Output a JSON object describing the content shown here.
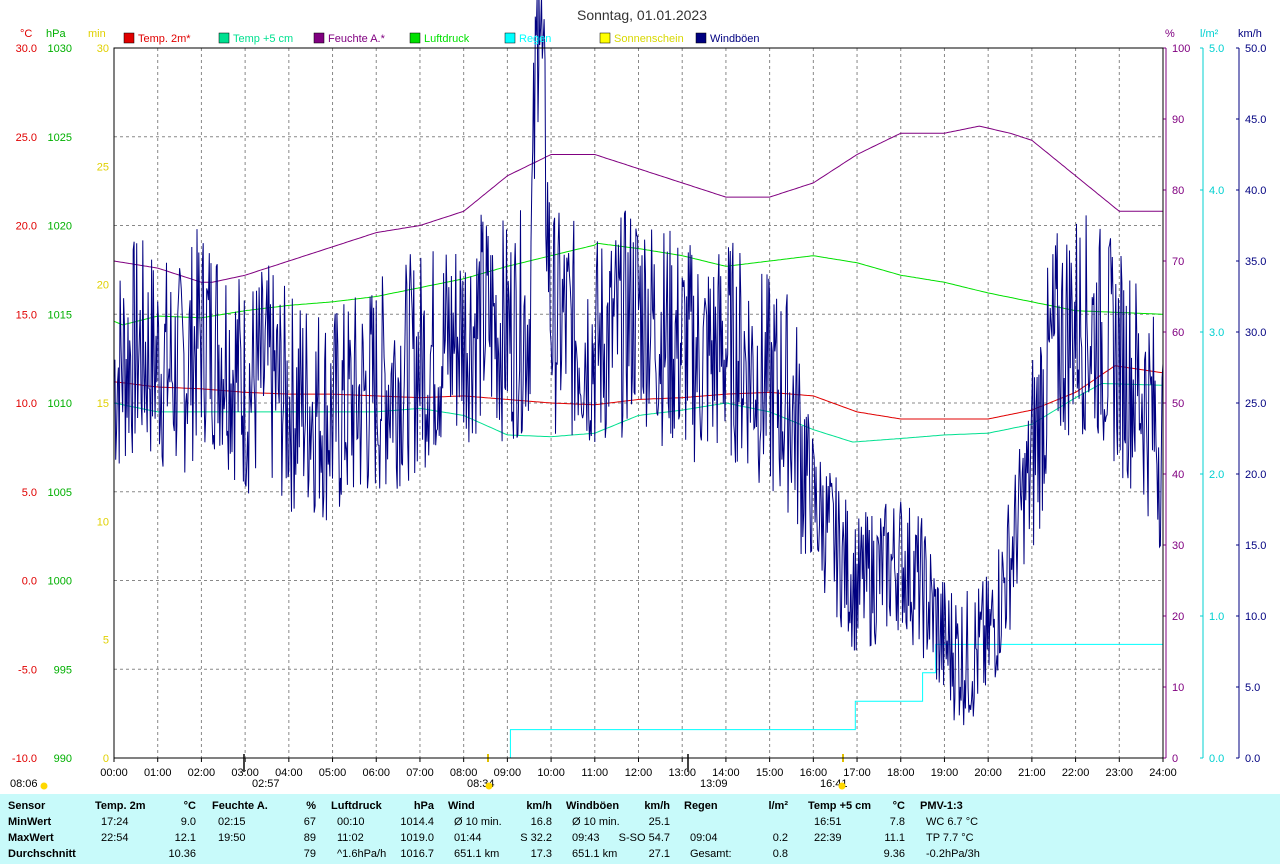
{
  "chart_data": {
    "type": "line",
    "title": "Sonntag, 01.01.2023",
    "x_ticks": [
      "00:00",
      "01:00",
      "02:00",
      "03:00",
      "04:00",
      "05:00",
      "06:00",
      "07:00",
      "08:00",
      "09:00",
      "10:00",
      "11:00",
      "12:00",
      "13:00",
      "14:00",
      "15:00",
      "16:00",
      "17:00",
      "18:00",
      "19:00",
      "20:00",
      "21:00",
      "22:00",
      "23:00",
      "24:00"
    ],
    "axes": {
      "temp": {
        "unit": "°C",
        "min": -10,
        "max": 30,
        "ticks": [
          "30.0",
          "25.0",
          "20.0",
          "15.0",
          "10.0",
          "5.0",
          "0.0",
          "-5.0",
          "-10.0"
        ]
      },
      "pressure": {
        "unit": "hPa",
        "min": 990,
        "max": 1030,
        "ticks": [
          "1030",
          "1025",
          "1020",
          "1015",
          "1010",
          "1005",
          "1000",
          "995",
          "990"
        ]
      },
      "sun": {
        "unit": "min",
        "min": 0,
        "max": 30,
        "ticks": [
          "30",
          "25",
          "20",
          "15",
          "10",
          "5",
          "0"
        ]
      },
      "humidity": {
        "unit": "%",
        "min": 0,
        "max": 100,
        "ticks": [
          "100",
          "90",
          "80",
          "70",
          "60",
          "50",
          "40",
          "30",
          "20",
          "10",
          "0"
        ]
      },
      "rain": {
        "unit": "l/m²",
        "min": 0,
        "max": 5,
        "ticks": [
          "5.0",
          "4.0",
          "3.0",
          "2.0",
          "1.0",
          "0.0"
        ]
      },
      "wind": {
        "unit": "km/h",
        "min": 0,
        "max": 50,
        "ticks": [
          "50.0",
          "45.0",
          "40.0",
          "35.0",
          "30.0",
          "25.0",
          "20.0",
          "15.0",
          "10.0",
          "5.0",
          "0.0"
        ]
      }
    },
    "legend": [
      {
        "name": "Temp. 2m*",
        "color": "#e00000"
      },
      {
        "name": "Temp +5 cm",
        "color": "#00e090"
      },
      {
        "name": "Feuchte A.*",
        "color": "#800080"
      },
      {
        "name": "Luftdruck",
        "color": "#00e000"
      },
      {
        "name": "Regen",
        "color": "#00ffff"
      },
      {
        "name": "Sonnenschein",
        "color": "#ffff00"
      },
      {
        "name": "Windböen",
        "color": "#000080"
      }
    ],
    "series": [
      {
        "name": "Temp. 2m*",
        "axis": "temp",
        "color": "#e00000",
        "x": [
          0,
          1,
          2,
          3,
          4,
          5,
          6,
          7,
          8,
          9,
          10,
          11,
          12,
          13,
          14,
          15,
          16,
          17,
          18,
          19,
          20,
          21,
          22,
          22.9,
          24
        ],
        "values": [
          11.2,
          10.9,
          10.8,
          10.6,
          10.5,
          10.5,
          10.4,
          10.3,
          10.4,
          10.2,
          10.0,
          9.9,
          10.2,
          10.3,
          10.5,
          10.6,
          10.4,
          9.5,
          9.1,
          9.1,
          9.1,
          9.6,
          10.6,
          12.1,
          11.7
        ]
      },
      {
        "name": "Temp +5 cm",
        "axis": "temp",
        "color": "#00e090",
        "x": [
          0,
          1,
          2,
          3,
          4,
          5,
          6,
          7,
          8,
          9,
          10,
          11,
          12,
          13,
          14,
          15,
          16,
          16.9,
          18,
          19,
          20,
          21,
          22,
          22.6,
          24
        ],
        "values": [
          10,
          9.5,
          9.5,
          9.5,
          9.5,
          9.5,
          9.5,
          9.7,
          9.3,
          8.2,
          8.1,
          8.3,
          9.3,
          9.6,
          10.0,
          9.5,
          8.5,
          7.8,
          8.0,
          8.2,
          8.3,
          8.8,
          10.3,
          11.1,
          11.0
        ]
      },
      {
        "name": "Feuchte A.*",
        "axis": "humidity",
        "color": "#800080",
        "x": [
          0,
          1,
          2,
          2.25,
          3,
          4,
          5,
          6,
          7,
          8,
          9,
          10,
          10.5,
          11,
          12,
          13,
          14,
          15,
          16,
          17,
          18,
          19,
          19.8,
          20.5,
          21,
          22,
          23,
          24
        ],
        "values": [
          70,
          69,
          67,
          67,
          68,
          70,
          72,
          74,
          75,
          77,
          82,
          85,
          85,
          85,
          83,
          81,
          79,
          79,
          81,
          85,
          88,
          88,
          89,
          88,
          87,
          82,
          77,
          77
        ]
      },
      {
        "name": "Luftdruck",
        "axis": "pressure",
        "color": "#00e000",
        "x": [
          0,
          0.2,
          1,
          2,
          3,
          4,
          5,
          6,
          7,
          8,
          9,
          10,
          11,
          11.05,
          12,
          13,
          14,
          15,
          16,
          17,
          18,
          19,
          20,
          21,
          22,
          23,
          24
        ],
        "values": [
          1014.6,
          1014.4,
          1014.9,
          1014.8,
          1015.2,
          1015.5,
          1015.7,
          1016.0,
          1016.5,
          1017.0,
          1017.7,
          1018.3,
          1018.9,
          1019.0,
          1018.7,
          1018.3,
          1017.7,
          1018.0,
          1018.3,
          1017.9,
          1017.2,
          1016.8,
          1016.2,
          1015.7,
          1015.2,
          1015.1,
          1015.0
        ]
      },
      {
        "name": "Regen",
        "axis": "rain",
        "color": "#00ffff",
        "x": [
          0,
          9.06,
          9.07,
          16.95,
          16.96,
          18.3,
          18.5,
          18.8,
          24
        ],
        "values": [
          0,
          0,
          0.2,
          0.2,
          0.4,
          0.4,
          0.6,
          0.8,
          0.8
        ]
      },
      {
        "name": "Windböen",
        "axis": "wind",
        "color": "#000080",
        "x": [
          0,
          0.5,
          1,
          1.5,
          2,
          2.5,
          3,
          3.5,
          4,
          4.5,
          5,
          5.5,
          6,
          6.5,
          7,
          7.5,
          8,
          8.5,
          9,
          9.5,
          9.72,
          10,
          10.5,
          11,
          11.5,
          12,
          12.5,
          13,
          13.5,
          14,
          14.5,
          15,
          15.5,
          16,
          16.5,
          17,
          17.5,
          18,
          18.5,
          19,
          19.5,
          20,
          20.5,
          21,
          21.5,
          22,
          22.5,
          23,
          23.5,
          24
        ],
        "values": [
          27,
          29,
          28,
          27,
          30,
          29,
          26,
          27,
          25,
          25,
          24,
          25,
          26,
          27,
          28,
          29,
          30,
          31,
          30,
          31,
          54.7,
          31,
          30,
          29,
          30,
          32,
          30,
          29,
          28,
          29,
          28,
          26,
          25,
          18,
          15,
          12,
          13,
          14,
          12,
          8,
          7,
          8,
          14,
          21,
          29,
          31,
          30,
          28,
          26,
          22
        ]
      }
    ],
    "markers": [
      {
        "label": "08:06"
      },
      {
        "label": "02:57"
      },
      {
        "label": "08:34"
      },
      {
        "label": "13:09"
      },
      {
        "label": "16:41"
      }
    ]
  },
  "stats": {
    "headers": [
      {
        "label": "Sensor",
        "unit": ""
      },
      {
        "label": "Temp. 2m",
        "unit": "°C"
      },
      {
        "label": "Feuchte A.",
        "unit": "%"
      },
      {
        "label": "Luftdruck",
        "unit": "hPa"
      },
      {
        "label": "Wind",
        "unit": "km/h"
      },
      {
        "label": "Windböen",
        "unit": "km/h"
      },
      {
        "label": "Regen",
        "unit": "l/m²"
      },
      {
        "label": "Temp +5 cm",
        "unit": "°C"
      },
      {
        "label": "PMV-1:3",
        "unit": ""
      }
    ],
    "rows": [
      {
        "label": "MinWert",
        "cells": [
          [
            "17:24",
            "9.0"
          ],
          [
            "02:15",
            "67"
          ],
          [
            "00:10",
            "1014.4"
          ],
          [
            "Ø 10 min.",
            "16.8"
          ],
          [
            "Ø 10 min.",
            "25.1"
          ],
          [
            "",
            ""
          ],
          [
            "16:51",
            "7.8"
          ],
          [
            "WC 6.7 °C",
            ""
          ]
        ]
      },
      {
        "label": "MaxWert",
        "cells": [
          [
            "22:54",
            "12.1"
          ],
          [
            "19:50",
            "89"
          ],
          [
            "11:02",
            "1019.0"
          ],
          [
            "01:44",
            "S 32.2"
          ],
          [
            "09:43",
            "S-SO 54.7"
          ],
          [
            "09:04",
            "0.2"
          ],
          [
            "22:39",
            "11.1"
          ],
          [
            "TP 7.7 °C",
            ""
          ]
        ]
      },
      {
        "label": "Durchschnitt",
        "cells": [
          [
            "",
            "10.36"
          ],
          [
            "",
            "79"
          ],
          [
            "^1.6hPa/h",
            "1016.7"
          ],
          [
            "651.1 km",
            "17.3"
          ],
          [
            "651.1 km",
            "27.1"
          ],
          [
            "Gesamt:",
            "0.8"
          ],
          [
            "",
            "9.36"
          ],
          [
            "-0.2hPa/3h",
            ""
          ]
        ]
      }
    ]
  }
}
